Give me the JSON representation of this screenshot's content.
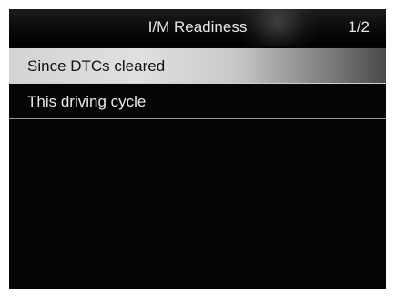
{
  "header": {
    "title": "I/M Readiness",
    "page": "1/2"
  },
  "menu": {
    "selected_index": 0,
    "items": [
      {
        "label": "Since DTCs cleared"
      },
      {
        "label": "This driving cycle"
      }
    ]
  },
  "colors": {
    "background": "#050505",
    "text": "#e8e8e8",
    "selected_text": "#111111",
    "selected_highlight": "#d4d4d4"
  }
}
